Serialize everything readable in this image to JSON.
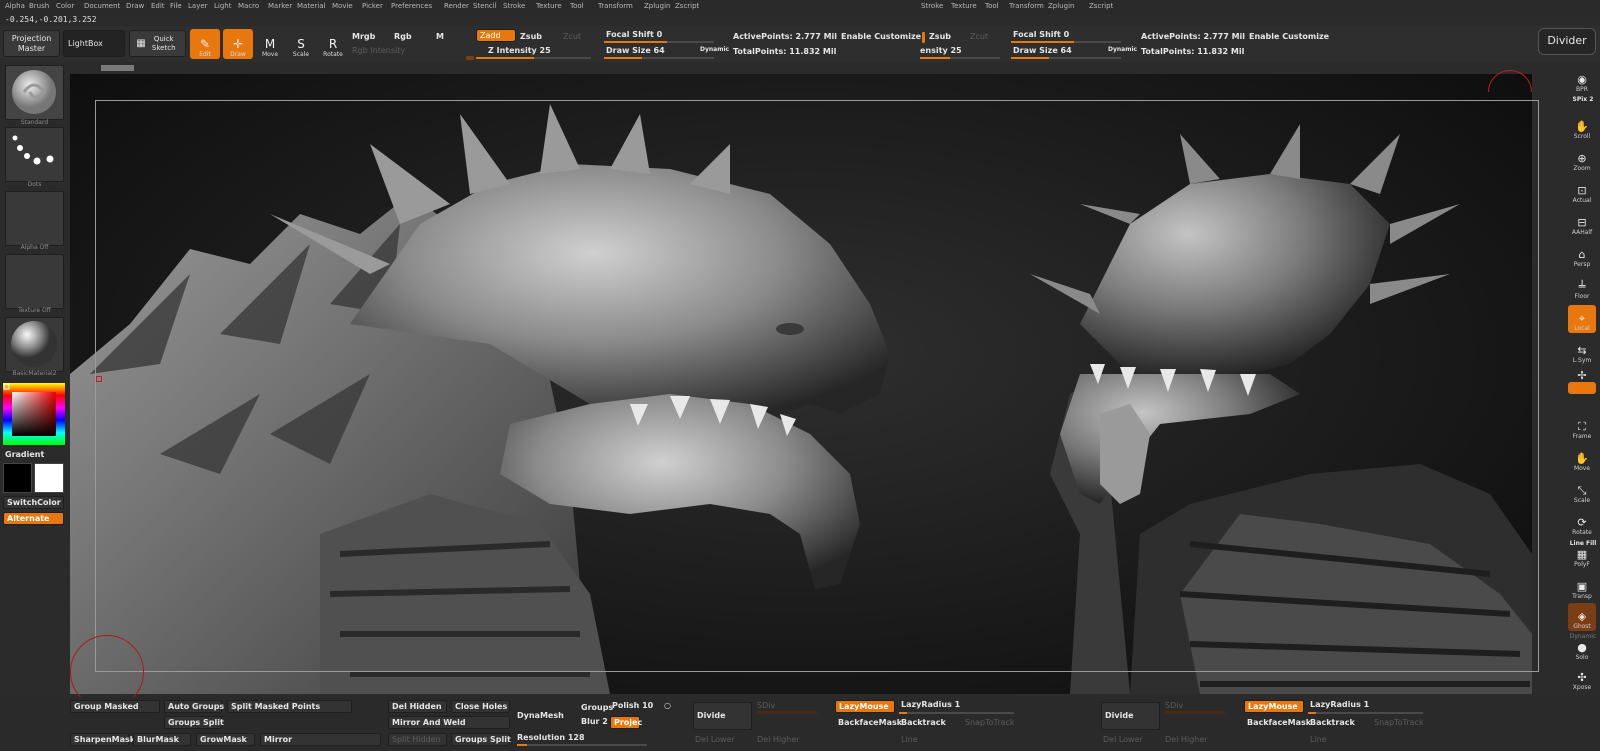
{
  "menu": [
    "Alpha",
    "Brush",
    "Color",
    "Document",
    "Draw",
    "Edit",
    "File",
    "Layer",
    "Light",
    "Macro",
    "Marker",
    "Material",
    "Movie",
    "Picker",
    "Preferences",
    "Render",
    "Stencil",
    "Stroke",
    "Texture",
    "Tool",
    "Transform",
    "Zplugin",
    "Zscript"
  ],
  "menu_right": [
    "Stroke",
    "Texture",
    "Tool",
    "Transform",
    "Zplugin",
    "Zscript"
  ],
  "coords": "-0.254,-0.201,3.252",
  "toolbar": {
    "projection_master": "Projection Master",
    "lightbox": "LightBox",
    "quick_sketch": "Quick Sketch",
    "edit": "Edit",
    "draw": "Draw",
    "move": "Move",
    "scale": "Scale",
    "rotate": "Rotate",
    "mrgb": "Mrgb",
    "rgb": "Rgb",
    "m": "M",
    "rgb_intensity": "Rgb Intensity",
    "zadd": "Zadd",
    "zsub": "Zsub",
    "zcut": "Zcut",
    "z_intensity": "Z Intensity 25",
    "focal_shift": "Focal Shift 0",
    "draw_size": "Draw Size 64",
    "dynamic": "Dynamic",
    "active_points": "ActivePoints: 2.777 Mil",
    "total_points": "TotalPoints: 11.832 Mil",
    "enable_customize": "Enable Customize",
    "dup_zsub": "Zsub",
    "dup_zcut": "Zcut",
    "dup_intensity": "ensity 25",
    "dup_focal_shift": "Focal Shift 0",
    "dup_draw_size": "Draw Size 64",
    "dup_dynamic": "Dynamic",
    "dup_active_points": "ActivePoints: 2.777 Mil",
    "dup_total_points": "TotalPoints: 11.832 Mil",
    "dup_enable_customize": "Enable Customize",
    "divider": "Divider",
    "z_intensity_value": 25,
    "draw_size_value": 64
  },
  "left_shelf": {
    "brush": "Standard",
    "stroke": "Dots",
    "alpha": "Alpha Off",
    "texture": "Texture Off",
    "material": "BasicMaterial2",
    "gradient": "Gradient",
    "switch_color": "SwitchColor",
    "alternate": "Alternate"
  },
  "right_shelf": [
    "BPR",
    "SPix 2",
    "Scroll",
    "Zoom",
    "Actual",
    "AAHalf",
    "Persp",
    "Floor",
    "Local",
    "L.Sym",
    "XYZ",
    "Frame",
    "Move",
    "Scale",
    "Rotate",
    "Line Fill",
    "PolyF",
    "Transp",
    "Ghost",
    "Solo",
    "Xpose"
  ],
  "right_shelf_extra": {
    "dynamic": "Dynamic"
  },
  "bottom": {
    "group_masked": "Group Masked",
    "auto_groups": "Auto Groups",
    "split_masked_points": "Split Masked Points",
    "groups_split": "Groups Split",
    "sharpen_mask": "SharpenMask",
    "blur_mask": "BlurMask",
    "grow_mask": "GrowMask",
    "mirror": "Mirror",
    "del_hidden": "Del Hidden",
    "close_holes": "Close Holes",
    "mirror_and_weld": "Mirror And Weld",
    "split_hidden": "Split Hidden",
    "groups_split_2": "Groups Split",
    "dynamesh": "DynaMesh",
    "groups": "Groups",
    "polish": "Polish 10",
    "blur": "Blur 2",
    "project": "Projec",
    "resolution": "Resolution 128",
    "divide": "Divide",
    "sdiv": "SDiv",
    "del_lower": "Del Lower",
    "del_higher": "Del Higher",
    "lazy_mouse": "LazyMouse",
    "lazy_radius": "LazyRadius 1",
    "backface_mask": "BackfaceMask",
    "backtrack": "Backtrack",
    "snap_to_track": "SnapToTrack",
    "line": "Line",
    "divide_2": "Divide",
    "sdiv_2": "SDiv",
    "del_lower_2": "Del Lower",
    "del_higher_2": "Del Higher",
    "lazy_mouse_2": "LazyMouse",
    "lazy_radius_2": "LazyRadius 1",
    "backface_mask_2": "BackfaceMask",
    "backtrack_2": "Backtrack",
    "snap_to_track_2": "SnapToTrack",
    "line_2": "Line"
  },
  "colors": {
    "accent": "#e8780e",
    "panel": "#2e2e2e",
    "canvas": "#1b1b1b"
  }
}
